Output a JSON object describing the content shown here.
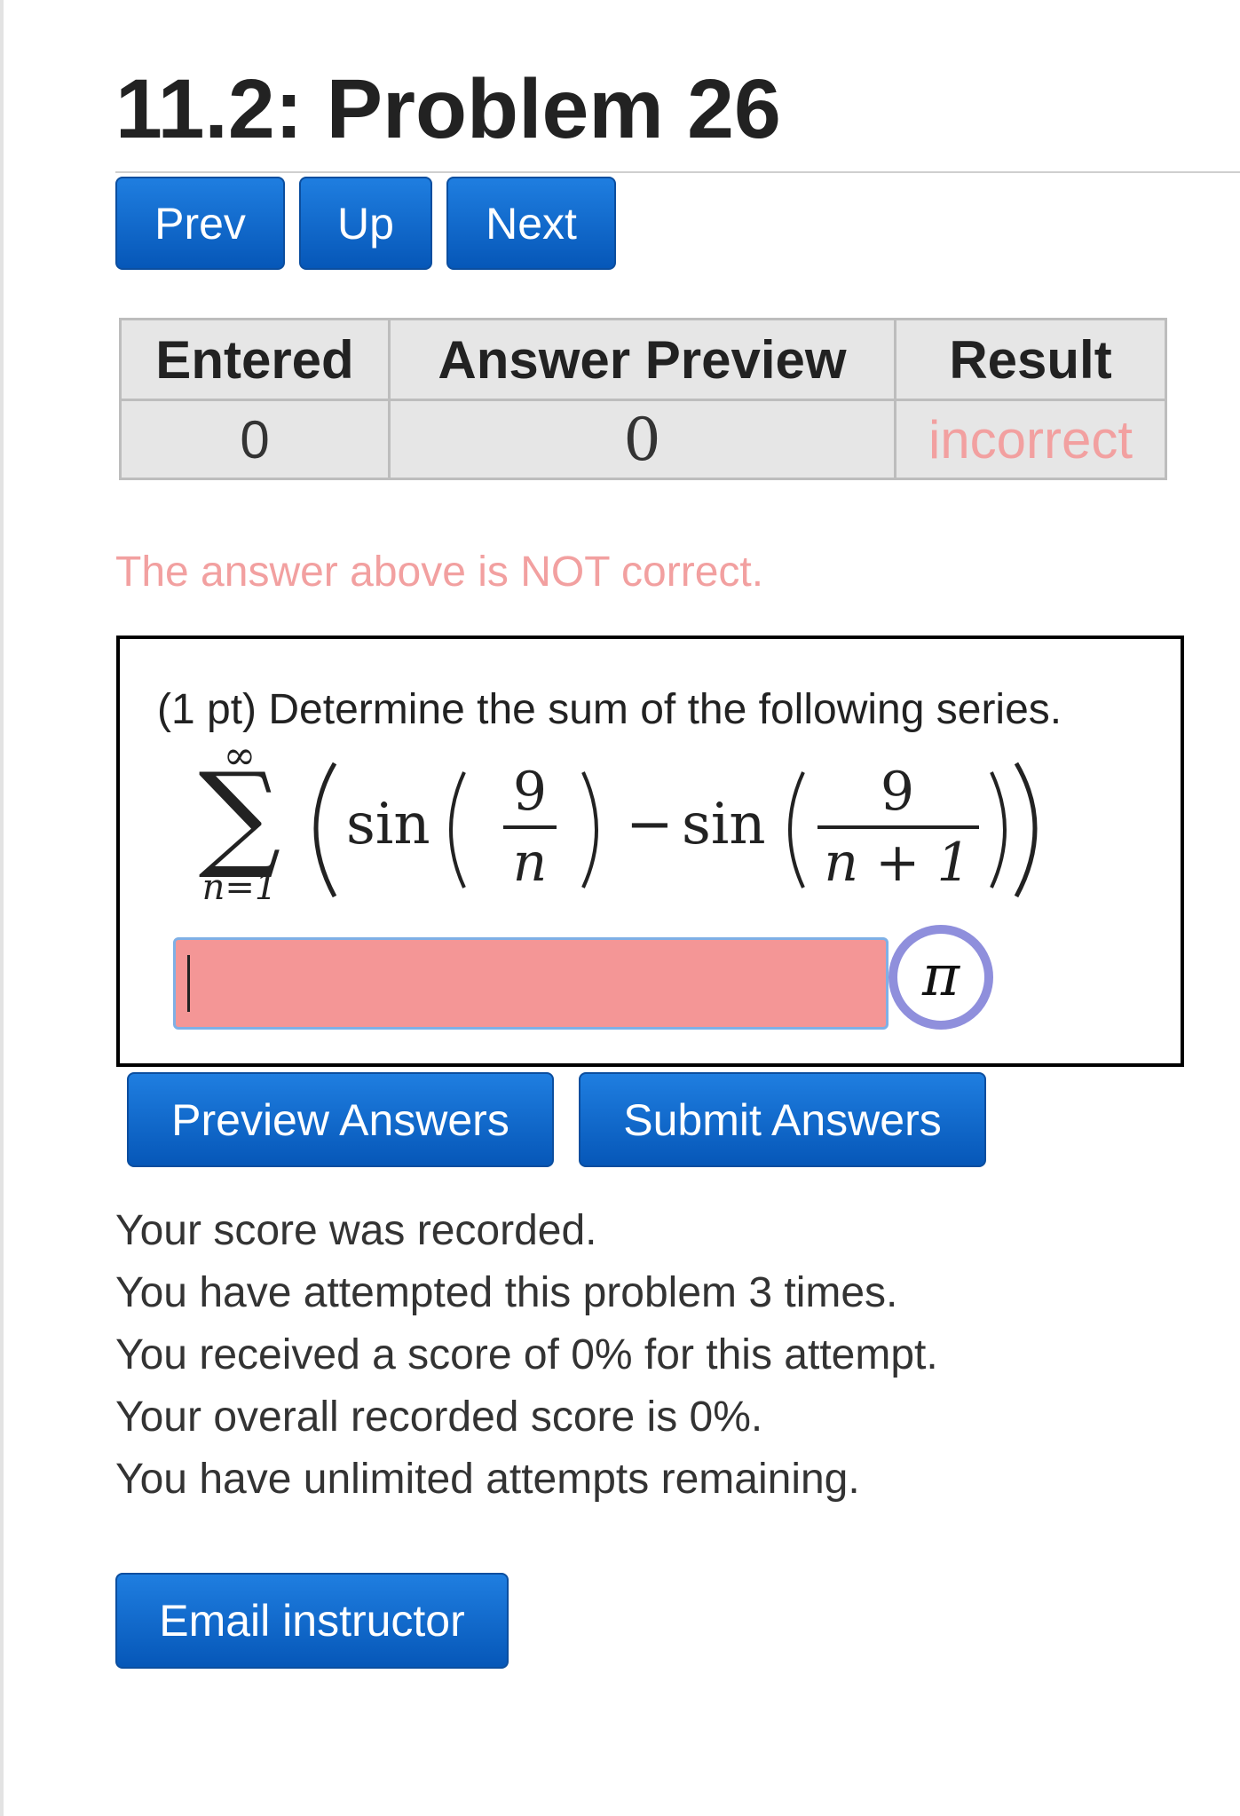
{
  "page": {
    "title": "11.2: Problem 26"
  },
  "nav": {
    "prev_label": "Prev",
    "up_label": "Up",
    "next_label": "Next"
  },
  "results_table": {
    "headers": [
      "Entered",
      "Answer Preview",
      "Result"
    ],
    "rows": [
      {
        "entered": "0",
        "preview": "0",
        "result": "incorrect"
      }
    ]
  },
  "feedback": {
    "message": "The answer above is NOT correct."
  },
  "problem": {
    "points": "(1 pt)",
    "statement": "Determine the sum of the following series.",
    "math": {
      "sum_lower": "n=1",
      "sum_upper": "∞",
      "func": "sin",
      "numerator": "9",
      "denominator_1": "n",
      "denominator_2": "n + 1",
      "minus": "−"
    },
    "answer": {
      "value": "",
      "placeholder": ""
    },
    "pi_button": {
      "symbol": "π",
      "icon": "pi-symbol-icon"
    }
  },
  "actions": {
    "preview_label": "Preview Answers",
    "submit_label": "Submit Answers"
  },
  "status": {
    "lines": [
      "Your score was recorded.",
      "You have attempted this problem 3 times.",
      "You received a score of 0% for this attempt.",
      "Your overall recorded score is 0%.",
      "You have unlimited attempts remaining."
    ]
  },
  "email": {
    "label": "Email instructor"
  },
  "colors": {
    "button_blue": "#0b68cc",
    "error_text": "#f2a0a0",
    "answer_fill": "#f49696",
    "pi_ring": "#8f8fdc"
  }
}
